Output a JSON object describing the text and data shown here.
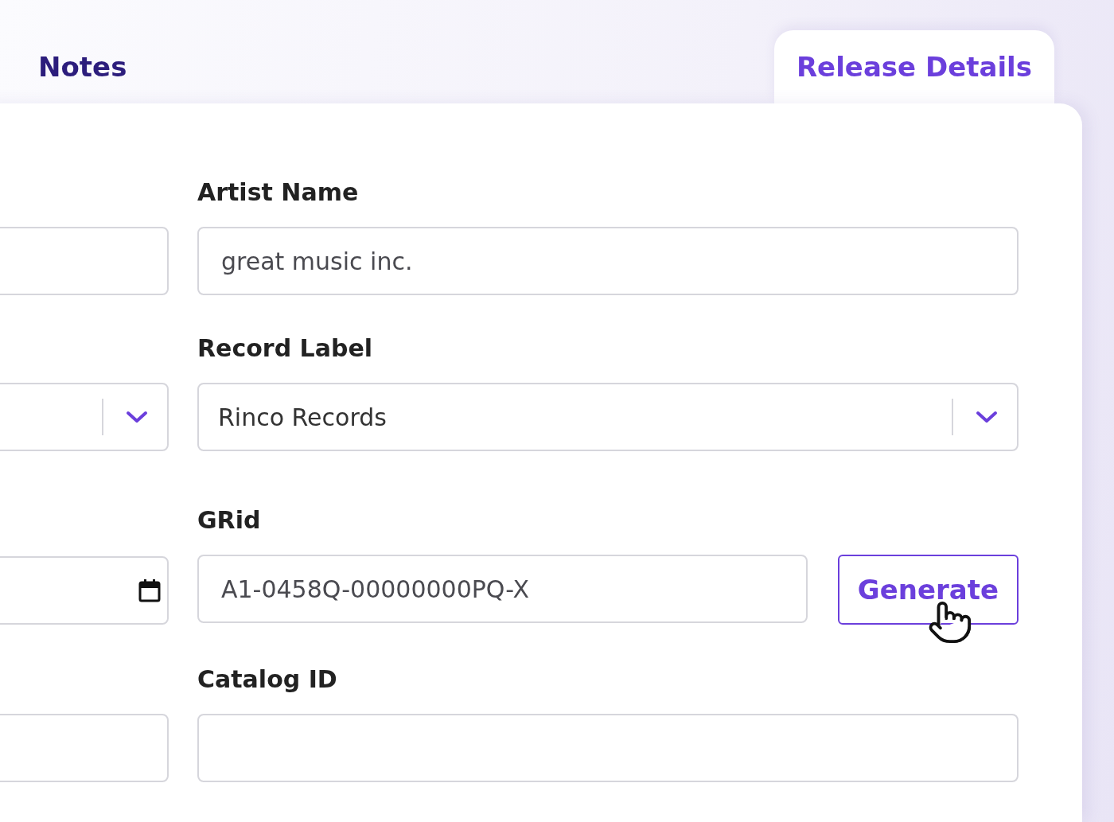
{
  "tabs": [
    {
      "label": "Notes",
      "selected": false
    },
    {
      "label": "Release Details",
      "selected": true
    }
  ],
  "left_fields": [
    {
      "kind": "text"
    },
    {
      "kind": "select"
    },
    {
      "kind": "date"
    },
    {
      "kind": "text"
    }
  ],
  "fields": [
    {
      "label": "Artist Name",
      "kind": "text",
      "value": "great music inc."
    },
    {
      "label": "Record Label",
      "kind": "select",
      "value": "Rinco Records"
    },
    {
      "label": "GRid",
      "kind": "text",
      "value": "A1-0458Q-00000000PQ-X",
      "button": "Generate"
    },
    {
      "label": "Catalog ID",
      "kind": "text"
    }
  ]
}
